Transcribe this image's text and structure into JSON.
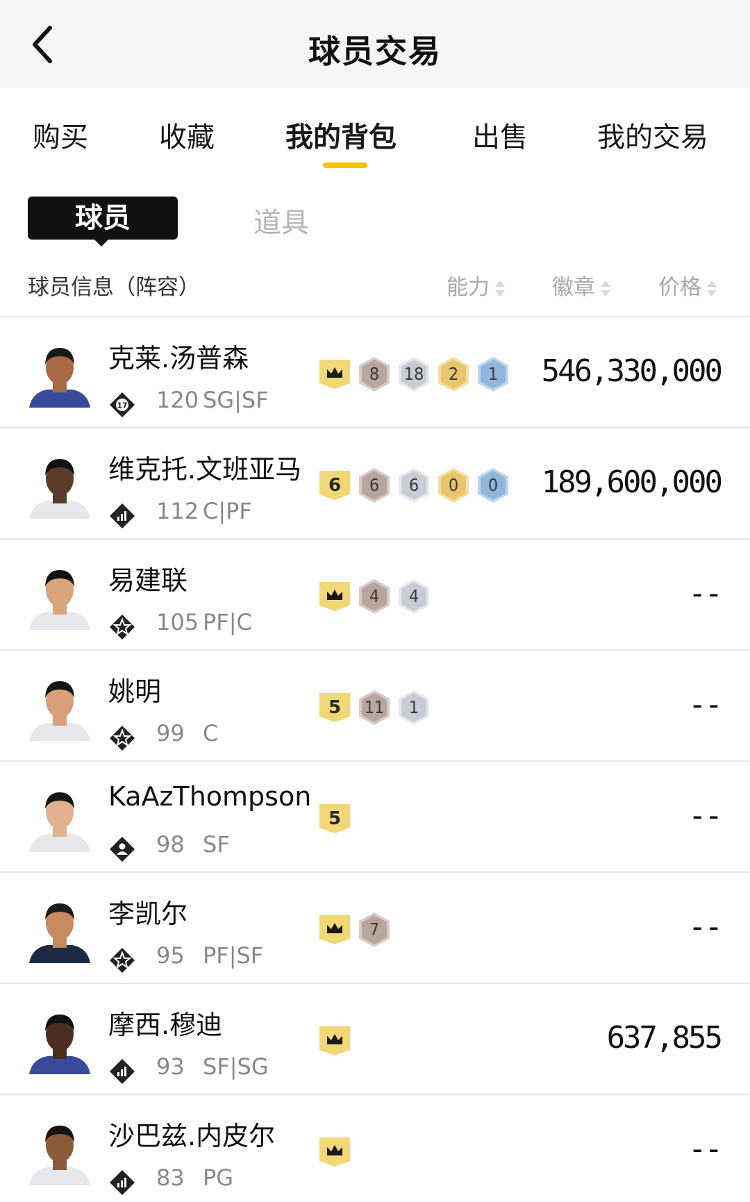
{
  "header": {
    "title": "球员交易"
  },
  "tabs": [
    {
      "label": "购买"
    },
    {
      "label": "收藏"
    },
    {
      "label": "我的背包",
      "active": true
    },
    {
      "label": "出售"
    },
    {
      "label": "我的交易"
    }
  ],
  "segment": {
    "active": "球员",
    "inactive": "道具"
  },
  "columns": {
    "info": "球员信息（阵容）",
    "ability": "能力",
    "badge": "徽章",
    "price": "价格"
  },
  "colors": {
    "accent": "#f5c400",
    "bronze": "#b8a69c",
    "silver": "#c9ccd4",
    "gold": "#e8c66e",
    "hof": "#8fb6dc"
  },
  "players": [
    {
      "name": "克莱.汤普森",
      "tier_icon": "number-17-diamond-icon",
      "tier_text": "17",
      "ovr": "120",
      "pos": "SG|SF",
      "card": {
        "type": "crown"
      },
      "badges": [
        {
          "v": "8",
          "t": "bronze"
        },
        {
          "v": "18",
          "t": "silver"
        },
        {
          "v": "2",
          "t": "gold"
        },
        {
          "v": "1",
          "t": "hof"
        }
      ],
      "price": "546,330,000"
    },
    {
      "name": "维克托.文班亚马",
      "tier_icon": "bar-chart-diamond-icon",
      "tier_text": "",
      "ovr": "112",
      "pos": "C|PF",
      "card": {
        "type": "number",
        "value": "6"
      },
      "badges": [
        {
          "v": "6",
          "t": "bronze"
        },
        {
          "v": "6",
          "t": "silver"
        },
        {
          "v": "0",
          "t": "gold"
        },
        {
          "v": "0",
          "t": "hof"
        }
      ],
      "price": "189,600,000"
    },
    {
      "name": "易建联",
      "tier_icon": "star-diamond-icon",
      "tier_text": "",
      "ovr": "105",
      "pos": "PF|C",
      "card": {
        "type": "crown"
      },
      "badges": [
        {
          "v": "4",
          "t": "bronze"
        },
        {
          "v": "4",
          "t": "silver"
        }
      ],
      "price": "--"
    },
    {
      "name": "姚明",
      "tier_icon": "star-diamond-icon",
      "tier_text": "",
      "ovr": "99",
      "pos": "C",
      "card": {
        "type": "number",
        "value": "5"
      },
      "badges": [
        {
          "v": "11",
          "t": "bronze"
        },
        {
          "v": "1",
          "t": "silver"
        }
      ],
      "price": "--"
    },
    {
      "name": "KaAzThompson",
      "tier_icon": "person-diamond-icon",
      "tier_text": "",
      "ovr": "98",
      "pos": "SF",
      "card": {
        "type": "number",
        "value": "5"
      },
      "badges": [],
      "price": "--"
    },
    {
      "name": "李凯尔",
      "tier_icon": "star-diamond-icon",
      "tier_text": "",
      "ovr": "95",
      "pos": "PF|SF",
      "card": {
        "type": "crown"
      },
      "badges": [
        {
          "v": "7",
          "t": "bronze"
        }
      ],
      "price": "--"
    },
    {
      "name": "摩西.穆迪",
      "tier_icon": "bar-chart-diamond-icon",
      "tier_text": "",
      "ovr": "93",
      "pos": "SF|SG",
      "card": {
        "type": "crown"
      },
      "badges": [],
      "price": "637,855"
    },
    {
      "name": "沙巴兹.内皮尔",
      "tier_icon": "bar-chart-diamond-icon",
      "tier_text": "",
      "ovr": "83",
      "pos": "PG",
      "card": {
        "type": "crown"
      },
      "badges": [],
      "price": "--"
    }
  ]
}
